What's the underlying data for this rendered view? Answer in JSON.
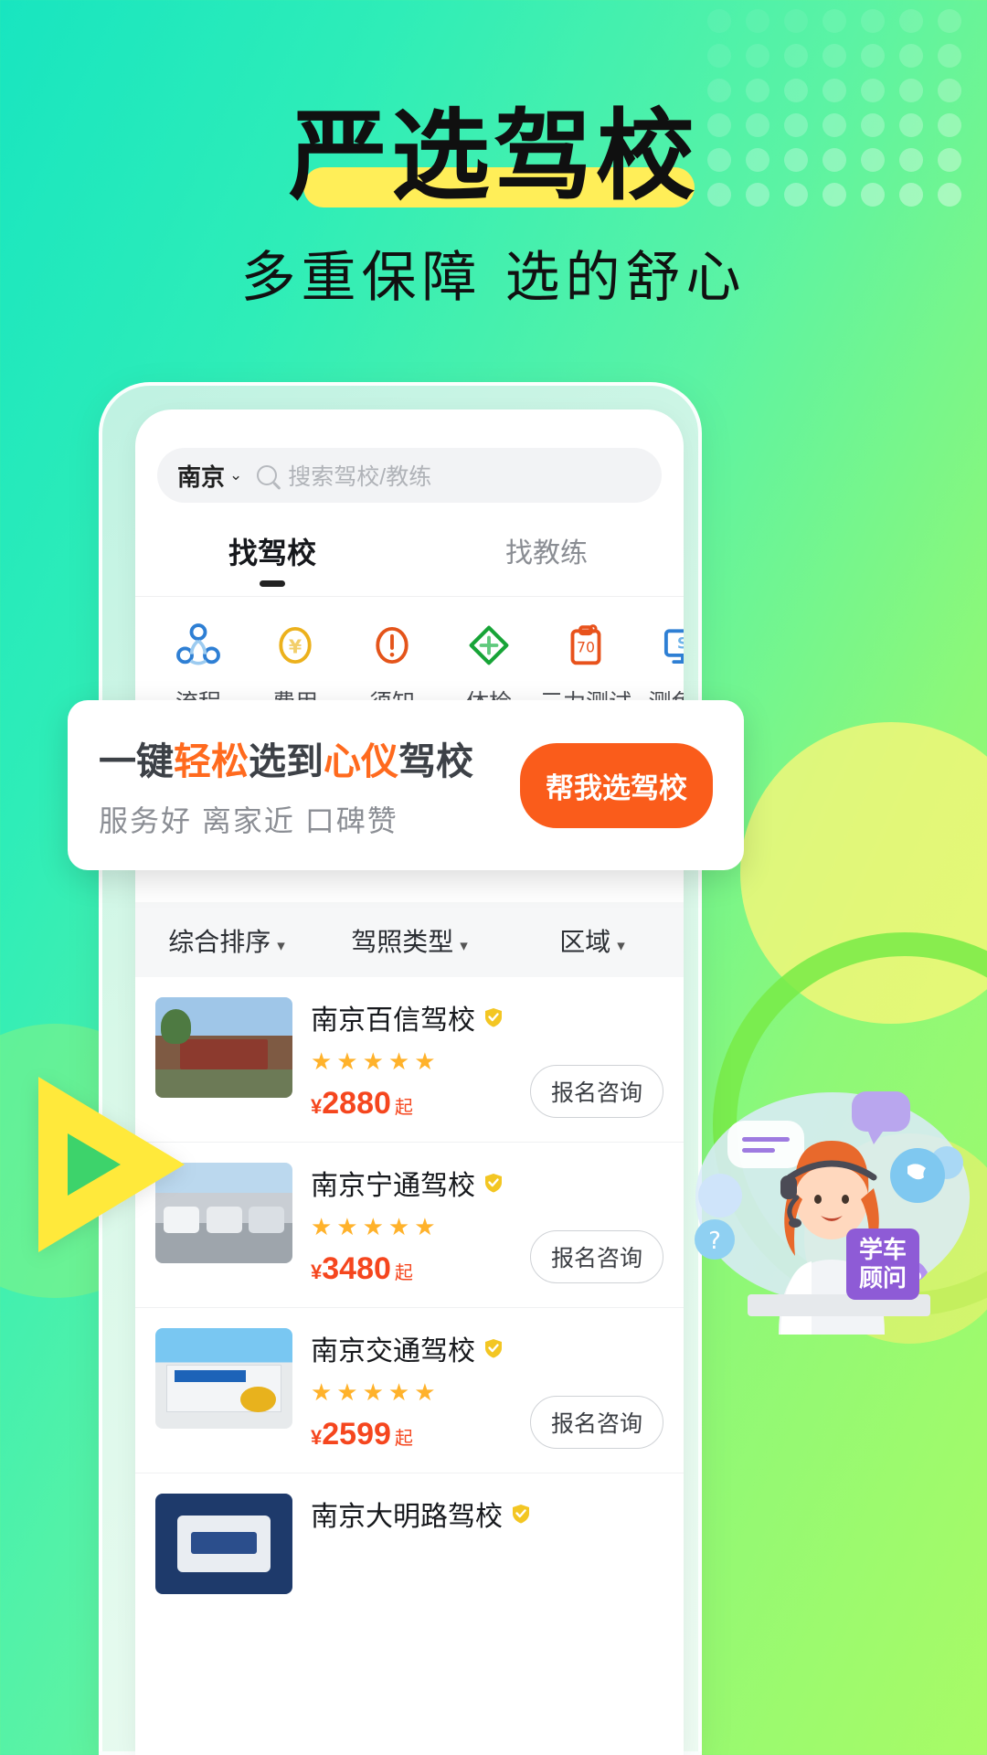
{
  "hero": {
    "title": "严选驾校",
    "subtitle": "多重保障 选的舒心",
    "highlight_color": "#FFEE58"
  },
  "app": {
    "search": {
      "city": "南京",
      "caret": "⌄",
      "placeholder": "搜索驾校/教练",
      "search_icon": "search-icon"
    },
    "tabs": [
      {
        "label": "找驾校",
        "active": true
      },
      {
        "label": "找教练",
        "active": false
      }
    ],
    "quick_icons": [
      {
        "label": "流程",
        "icon": "process-icon",
        "color": "#2E7FD4"
      },
      {
        "label": "费用",
        "icon": "yen-coin-icon",
        "color": "#ECB11C"
      },
      {
        "label": "须知",
        "icon": "exclamation-icon",
        "color": "#E4541A"
      },
      {
        "label": "体检",
        "icon": "medical-cross-icon",
        "color": "#17A437"
      },
      {
        "label": "三力测试",
        "icon": "clipboard-70-icon",
        "color": "#E8521C",
        "badge": "70"
      },
      {
        "label": "测色盲",
        "icon": "color-test-icon",
        "color": "#2E7FD4"
      }
    ],
    "promo": {
      "title_parts": [
        {
          "text": "一键",
          "accent": false
        },
        {
          "text": "轻松",
          "accent": true
        },
        {
          "text": "选到",
          "accent": false
        },
        {
          "text": "心仪",
          "accent": true
        },
        {
          "text": "驾校",
          "accent": false
        }
      ],
      "subtitle": "服务好 离家近 口碑赞",
      "button_label": "帮我选驾校",
      "button_color": "#FA5C1B",
      "accent_color": "#FF6A1E"
    },
    "filters": [
      {
        "label": "综合排序",
        "caret": "▾"
      },
      {
        "label": "驾照类型",
        "caret": "▾"
      },
      {
        "label": "区域",
        "caret": "▾"
      }
    ],
    "schools": [
      {
        "name": "南京百信驾校",
        "verified": true,
        "stars": "★★★★★",
        "currency": "¥",
        "price": "2880",
        "price_suffix": "起",
        "action": "报名咨询",
        "thumb": "school-photo-wall"
      },
      {
        "name": "南京宁通驾校",
        "verified": true,
        "stars": "★★★★★",
        "currency": "¥",
        "price": "3480",
        "price_suffix": "起",
        "action": "报名咨询",
        "thumb": "school-photo-cars"
      },
      {
        "name": "南京交通驾校",
        "verified": true,
        "stars": "★★★★★",
        "currency": "¥",
        "price": "2599",
        "price_suffix": "起",
        "action": "报名咨询",
        "thumb": "school-photo-building"
      },
      {
        "name": "南京大明路驾校",
        "verified": true,
        "stars": "",
        "currency": "",
        "price": "",
        "price_suffix": "",
        "action": "",
        "thumb": "school-photo-sign"
      }
    ]
  },
  "decor": {
    "consultant_badge_line1": "学车",
    "consultant_badge_line2": "顾问",
    "badge_color": "#8E5BD6"
  }
}
